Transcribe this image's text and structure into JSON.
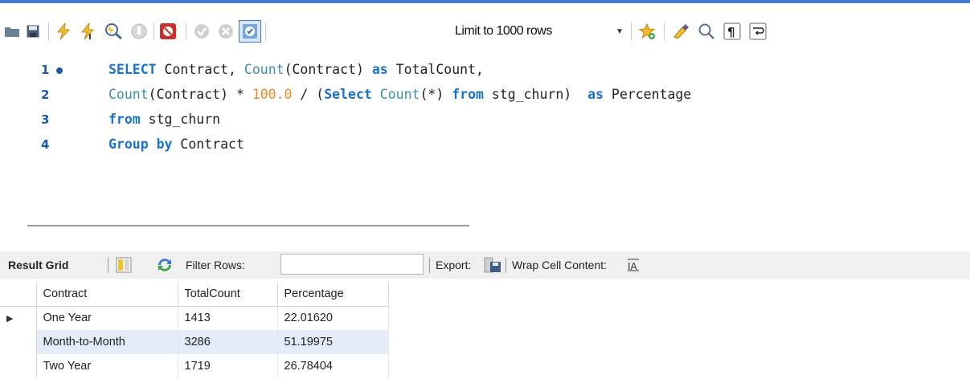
{
  "colors": {
    "accent": "#3d7cc9",
    "keyword": "#1a73c4",
    "function": "#3d8fa6",
    "number": "#e88a2a",
    "selected_row": "#e3ecf8"
  },
  "toolbar": {
    "icons": [
      "folder-icon",
      "save-icon",
      "execute-icon",
      "execute-current-icon",
      "explain-icon",
      "stop-icon",
      "toggle-error-icon",
      "commit-icon",
      "rollback-icon",
      "autocommit-icon",
      "beautify-icon",
      "find-icon",
      "invisible-chars-icon",
      "word-wrap-icon"
    ],
    "limit_label": "Limit to 1000 rows"
  },
  "editor": {
    "lines": [
      {
        "number": "1",
        "tokens": [
          {
            "t": "SELECT",
            "c": "kw"
          },
          {
            "t": " Contract, ",
            "c": "id"
          },
          {
            "t": "Count",
            "c": "fn"
          },
          {
            "t": "(Contract) ",
            "c": "id"
          },
          {
            "t": "as",
            "c": "kw"
          },
          {
            "t": " TotalCount,",
            "c": "id"
          }
        ]
      },
      {
        "number": "2",
        "tokens": [
          {
            "t": "Count",
            "c": "fn"
          },
          {
            "t": "(Contract) * ",
            "c": "id"
          },
          {
            "t": "100.0",
            "c": "num"
          },
          {
            "t": " / (",
            "c": "id"
          },
          {
            "t": "Select",
            "c": "kw"
          },
          {
            "t": " ",
            "c": "id"
          },
          {
            "t": "Count",
            "c": "fn"
          },
          {
            "t": "(*) ",
            "c": "id"
          },
          {
            "t": "from",
            "c": "kw"
          },
          {
            "t": " stg_churn)  ",
            "c": "id"
          },
          {
            "t": "as",
            "c": "kw"
          },
          {
            "t": " Percentage",
            "c": "id"
          }
        ]
      },
      {
        "number": "3",
        "tokens": [
          {
            "t": "from",
            "c": "kw"
          },
          {
            "t": " stg_churn",
            "c": "id"
          }
        ]
      },
      {
        "number": "4",
        "tokens": [
          {
            "t": "Group by",
            "c": "kw"
          },
          {
            "t": " Contract",
            "c": "id"
          }
        ]
      }
    ]
  },
  "result_toolbar": {
    "result_grid_label": "Result Grid",
    "filter_label": "Filter Rows:",
    "filter_value": "",
    "export_label": "Export:",
    "wrap_label": "Wrap Cell Content:"
  },
  "grid": {
    "columns": [
      "Contract",
      "TotalCount",
      "Percentage"
    ],
    "rows": [
      [
        "One Year",
        "1413",
        "22.01620"
      ],
      [
        "Month-to-Month",
        "3286",
        "51.19975"
      ],
      [
        "Two Year",
        "1719",
        "26.78404"
      ]
    ],
    "current_row_marker": "▶"
  }
}
